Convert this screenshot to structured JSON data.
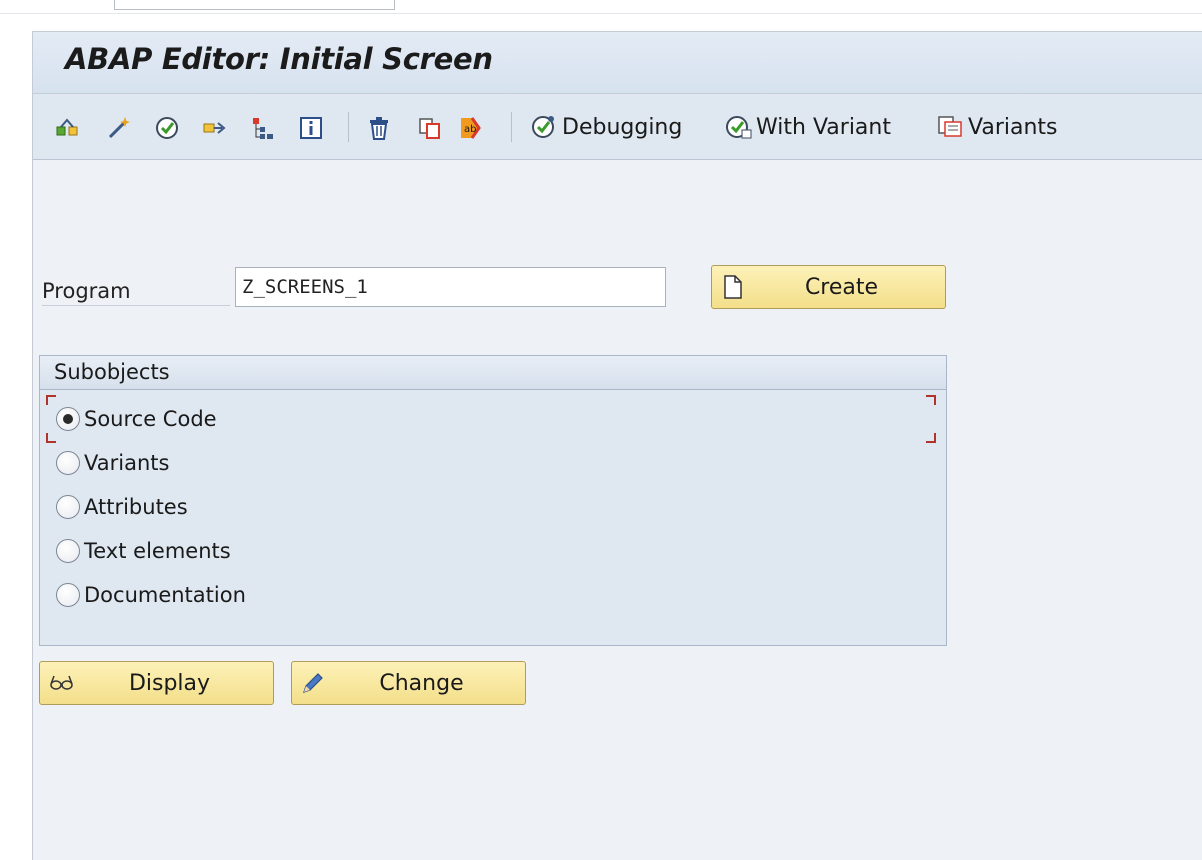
{
  "title": "ABAP Editor: Initial Screen",
  "toolbar": {
    "icons": [
      {
        "name": "other-object-icon"
      },
      {
        "name": "magic-wand-icon"
      },
      {
        "name": "check-icon"
      },
      {
        "name": "where-used-icon"
      },
      {
        "name": "hierarchy-icon"
      },
      {
        "name": "info-icon"
      },
      {
        "name": "delete-icon"
      },
      {
        "name": "copy-icon"
      },
      {
        "name": "rename-icon"
      }
    ],
    "debugging_label": "Debugging",
    "with_variant_label": "With Variant",
    "variants_label": "Variants"
  },
  "program": {
    "label": "Program",
    "value": "Z_SCREENS_1",
    "create_label": "Create"
  },
  "subobjects": {
    "title": "Subobjects",
    "options": [
      {
        "label": "Source Code",
        "checked": true
      },
      {
        "label": "Variants",
        "checked": false
      },
      {
        "label": "Attributes",
        "checked": false
      },
      {
        "label": "Text elements",
        "checked": false
      },
      {
        "label": "Documentation",
        "checked": false
      }
    ]
  },
  "actions": {
    "display_label": "Display",
    "change_label": "Change"
  },
  "colors": {
    "button_yellow": "#f8e7a0",
    "background": "#eef1f6",
    "toolbar": "#dfe7f1",
    "focus_marker": "#b0342a"
  }
}
